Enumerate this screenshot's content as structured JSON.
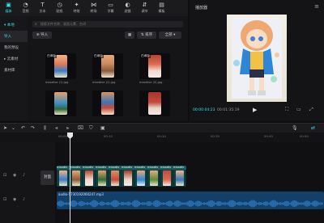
{
  "toolbar": {
    "tools": [
      {
        "label": "媒体",
        "icon": "media-icon",
        "active": true
      },
      {
        "label": "音频",
        "icon": "audio-icon"
      },
      {
        "label": "文本",
        "icon": "text-icon"
      },
      {
        "label": "贴纸",
        "icon": "sticker-icon"
      },
      {
        "label": "特效",
        "icon": "effects-icon"
      },
      {
        "label": "转场",
        "icon": "transition-icon"
      },
      {
        "label": "字幕",
        "icon": "caption-icon"
      },
      {
        "label": "滤镜",
        "icon": "filter-icon"
      },
      {
        "label": "调节",
        "icon": "adjust-icon"
      },
      {
        "label": "模板",
        "icon": "template-icon"
      }
    ]
  },
  "sidebar": {
    "items": [
      {
        "label": "▾ 本地",
        "active": true
      },
      {
        "label": "导入",
        "active": true
      },
      {
        "label": "我的预设"
      },
      {
        "label": "▸ 云素材"
      },
      {
        "label": "素材库"
      }
    ]
  },
  "media": {
    "search_placeholder": "搜索文件名称、画面元素、台词",
    "import_label": "导入",
    "sort_label": "排序",
    "filter_label": "全部",
    "items": [
      {
        "tag": "已添加",
        "name": "maxdive (1).jpg"
      },
      {
        "tag": "已添加",
        "name": "maxdive (2).jpg"
      },
      {
        "tag": "已添加",
        "name": "maxdive (3).jpg"
      },
      {
        "tag": "",
        "name": ""
      },
      {
        "tag": "",
        "name": ""
      },
      {
        "tag": "",
        "name": ""
      }
    ]
  },
  "player": {
    "title": "播放器",
    "time_current": "00:00:04:23",
    "time_total": "00:01:35:19"
  },
  "timeline": {
    "ruler": [
      "00:00",
      "00:10",
      "00:20",
      "00:30",
      "00:40",
      "00:50"
    ],
    "cover_label": "封面",
    "clip_label": "maxdiv",
    "audio_label": "audio-1730192060247.mp3"
  },
  "colors": {
    "accent": "#2ee6e6",
    "video_track": "#0e3d3d",
    "audio_track": "#11406b"
  }
}
